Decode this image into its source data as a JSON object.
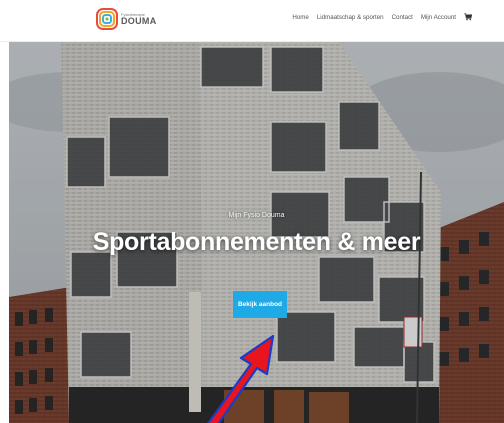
{
  "header": {
    "logo": {
      "small_text": "Fysiotherapie",
      "brand": "DOUMA"
    },
    "nav": [
      {
        "label": "Home"
      },
      {
        "label": "Lidmaatschap & sporten"
      },
      {
        "label": "Contact"
      },
      {
        "label": "Mijn Account"
      }
    ],
    "cart_icon": "cart-icon"
  },
  "hero": {
    "subtitle": "Mijn Fysio Douma",
    "title": "Sportabonnementen & meer",
    "cta_label": "Bekijk aanbod"
  },
  "annotation": {
    "arrow_color": "#e8141e",
    "arrow_outline": "#1a3cc8"
  },
  "colors": {
    "accent": "#1eaae7",
    "header_bg": "#ffffff"
  }
}
